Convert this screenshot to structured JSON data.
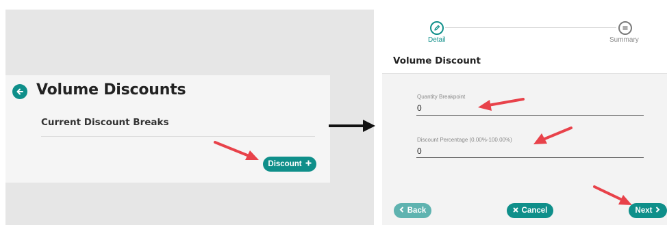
{
  "left": {
    "title": "Volume Discounts",
    "section_title": "Current Discount Breaks",
    "discount_button": "Discount"
  },
  "right": {
    "steps": [
      {
        "label": "Detail",
        "active": true
      },
      {
        "label": "Summary",
        "active": false
      }
    ],
    "form_title": "Volume Discount",
    "fields": {
      "quantity": {
        "label": "Quantity Breakpoint",
        "value": "0"
      },
      "percentage": {
        "label": "Discount Percentage (0.00%-100.00%)",
        "value": "0"
      }
    },
    "buttons": {
      "back": "Back",
      "cancel": "Cancel",
      "next": "Next"
    }
  },
  "colors": {
    "accent": "#0f8f8a",
    "annotation_arrow": "#e8424a"
  }
}
